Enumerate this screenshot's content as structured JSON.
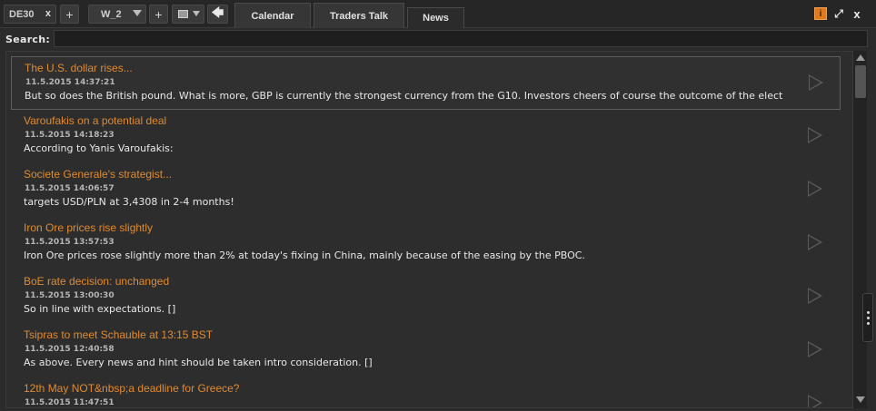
{
  "toolbar": {
    "symbol": "DE30",
    "symbol_close": "x",
    "add_label": "+",
    "workspace": "W_2",
    "add_workspace_label": "+",
    "back_label": "🡄"
  },
  "tabs": [
    {
      "label": "Calendar",
      "active": false
    },
    {
      "label": "Traders Talk",
      "active": false
    },
    {
      "label": "News",
      "active": true
    }
  ],
  "window_controls": {
    "info_label": "i",
    "expand_label": "⤢",
    "close_label": "x"
  },
  "search": {
    "label": "Search:",
    "value": ""
  },
  "news": [
    {
      "title": "The U.S. dollar rises...",
      "time": "11.5.2015 14:37:21",
      "body": "But so does the British pound. What is more, GBP is currently the strongest currency from the G10. Investors cheers of course the outcome of the elect"
    },
    {
      "title": "Varoufakis on a potential deal",
      "time": "11.5.2015 14:18:23",
      "body": "According to Yanis Varoufakis:"
    },
    {
      "title": "Societe Generale's strategist...",
      "time": "11.5.2015 14:06:57",
      "body": "targets USD/PLN at 3,4308 in 2-4 months!"
    },
    {
      "title": "Iron Ore prices rise slightly",
      "time": "11.5.2015 13:57:53",
      "body": "Iron Ore prices rose slightly more than 2% at today's fixing in China, mainly because of the easing by the PBOC."
    },
    {
      "title": "BoE rate decision: unchanged",
      "time": "11.5.2015 13:00:30",
      "body": "So in line with expectations. []"
    },
    {
      "title": "Tsipras to meet Schauble at 13:15 BST",
      "time": "11.5.2015 12:40:58",
      "body": "As above. Every news and hint should be taken intro consideration. []"
    },
    {
      "title": "12th May NOT&nbsp;a deadline for Greece?",
      "time": "11.5.2015 11:47:51",
      "body": ""
    }
  ],
  "colors": {
    "accent": "#e08a30",
    "background": "#2b2b2b",
    "info_badge": "#e07a1a"
  }
}
